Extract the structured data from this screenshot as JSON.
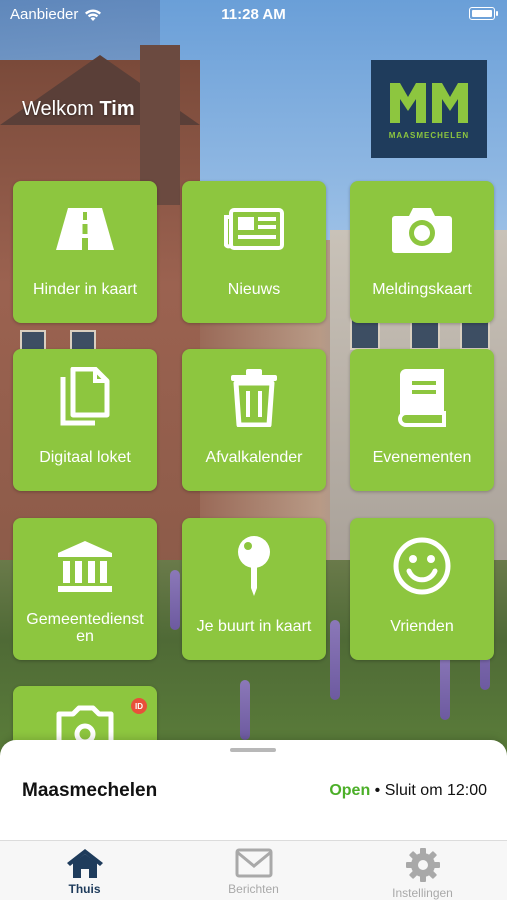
{
  "status_bar": {
    "carrier": "Aanbieder",
    "time": "11:28 AM",
    "battery_level": 1.0
  },
  "header": {
    "welcome_prefix": "Welkom",
    "user_name": "Tim"
  },
  "logo": {
    "text": "MAASMECHELEN"
  },
  "tiles": [
    {
      "label": "Hinder in kaart",
      "icon": "road-icon"
    },
    {
      "label": "Nieuws",
      "icon": "newspaper-icon"
    },
    {
      "label": "Meldingskaart",
      "icon": "camera-icon"
    },
    {
      "label": "Digitaal loket",
      "icon": "documents-icon"
    },
    {
      "label": "Afvalkalender",
      "icon": "trash-icon"
    },
    {
      "label": "Evenementen",
      "icon": "book-icon"
    },
    {
      "label": "Gemeentedienst\nen",
      "icon": "building-icon"
    },
    {
      "label": "Je buurt in kaart",
      "icon": "map-pin-icon"
    },
    {
      "label": "Vrienden",
      "icon": "smiley-icon"
    },
    {
      "label": "",
      "icon": "photo-map-icon",
      "badge": "ID"
    }
  ],
  "sheet": {
    "place": "Maasmechelen",
    "status": "Open",
    "separator": " • ",
    "closing": "Sluit om 12:00"
  },
  "tabs": [
    {
      "label": "Thuis",
      "icon": "home-icon",
      "active": true
    },
    {
      "label": "Berichten",
      "icon": "envelope-icon",
      "active": false
    },
    {
      "label": "Instellingen",
      "icon": "gear-icon",
      "active": false
    }
  ],
  "colors": {
    "tile": "#8dc63f",
    "brand_navy": "#1f3c5c",
    "open_green": "#4caf28"
  }
}
